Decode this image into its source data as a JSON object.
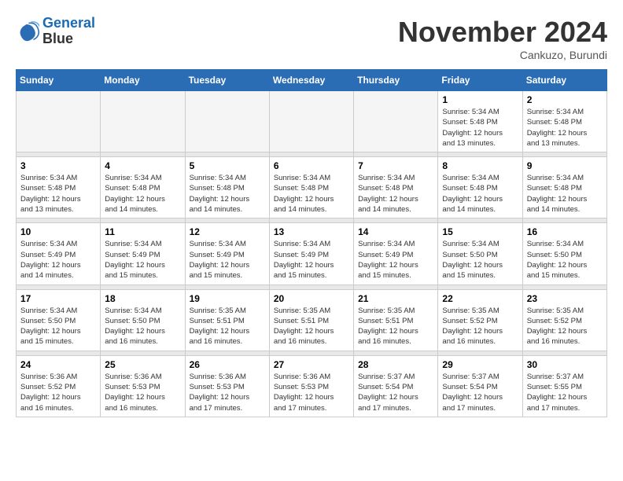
{
  "header": {
    "logo_line1": "General",
    "logo_line2": "Blue",
    "month_title": "November 2024",
    "location": "Cankuzo, Burundi"
  },
  "weekdays": [
    "Sunday",
    "Monday",
    "Tuesday",
    "Wednesday",
    "Thursday",
    "Friday",
    "Saturday"
  ],
  "weeks": [
    {
      "days": [
        {
          "num": "",
          "info": ""
        },
        {
          "num": "",
          "info": ""
        },
        {
          "num": "",
          "info": ""
        },
        {
          "num": "",
          "info": ""
        },
        {
          "num": "",
          "info": ""
        },
        {
          "num": "1",
          "info": "Sunrise: 5:34 AM\nSunset: 5:48 PM\nDaylight: 12 hours\nand 13 minutes."
        },
        {
          "num": "2",
          "info": "Sunrise: 5:34 AM\nSunset: 5:48 PM\nDaylight: 12 hours\nand 13 minutes."
        }
      ]
    },
    {
      "days": [
        {
          "num": "3",
          "info": "Sunrise: 5:34 AM\nSunset: 5:48 PM\nDaylight: 12 hours\nand 13 minutes."
        },
        {
          "num": "4",
          "info": "Sunrise: 5:34 AM\nSunset: 5:48 PM\nDaylight: 12 hours\nand 14 minutes."
        },
        {
          "num": "5",
          "info": "Sunrise: 5:34 AM\nSunset: 5:48 PM\nDaylight: 12 hours\nand 14 minutes."
        },
        {
          "num": "6",
          "info": "Sunrise: 5:34 AM\nSunset: 5:48 PM\nDaylight: 12 hours\nand 14 minutes."
        },
        {
          "num": "7",
          "info": "Sunrise: 5:34 AM\nSunset: 5:48 PM\nDaylight: 12 hours\nand 14 minutes."
        },
        {
          "num": "8",
          "info": "Sunrise: 5:34 AM\nSunset: 5:48 PM\nDaylight: 12 hours\nand 14 minutes."
        },
        {
          "num": "9",
          "info": "Sunrise: 5:34 AM\nSunset: 5:48 PM\nDaylight: 12 hours\nand 14 minutes."
        }
      ]
    },
    {
      "days": [
        {
          "num": "10",
          "info": "Sunrise: 5:34 AM\nSunset: 5:49 PM\nDaylight: 12 hours\nand 14 minutes."
        },
        {
          "num": "11",
          "info": "Sunrise: 5:34 AM\nSunset: 5:49 PM\nDaylight: 12 hours\nand 15 minutes."
        },
        {
          "num": "12",
          "info": "Sunrise: 5:34 AM\nSunset: 5:49 PM\nDaylight: 12 hours\nand 15 minutes."
        },
        {
          "num": "13",
          "info": "Sunrise: 5:34 AM\nSunset: 5:49 PM\nDaylight: 12 hours\nand 15 minutes."
        },
        {
          "num": "14",
          "info": "Sunrise: 5:34 AM\nSunset: 5:49 PM\nDaylight: 12 hours\nand 15 minutes."
        },
        {
          "num": "15",
          "info": "Sunrise: 5:34 AM\nSunset: 5:50 PM\nDaylight: 12 hours\nand 15 minutes."
        },
        {
          "num": "16",
          "info": "Sunrise: 5:34 AM\nSunset: 5:50 PM\nDaylight: 12 hours\nand 15 minutes."
        }
      ]
    },
    {
      "days": [
        {
          "num": "17",
          "info": "Sunrise: 5:34 AM\nSunset: 5:50 PM\nDaylight: 12 hours\nand 15 minutes."
        },
        {
          "num": "18",
          "info": "Sunrise: 5:34 AM\nSunset: 5:50 PM\nDaylight: 12 hours\nand 16 minutes."
        },
        {
          "num": "19",
          "info": "Sunrise: 5:35 AM\nSunset: 5:51 PM\nDaylight: 12 hours\nand 16 minutes."
        },
        {
          "num": "20",
          "info": "Sunrise: 5:35 AM\nSunset: 5:51 PM\nDaylight: 12 hours\nand 16 minutes."
        },
        {
          "num": "21",
          "info": "Sunrise: 5:35 AM\nSunset: 5:51 PM\nDaylight: 12 hours\nand 16 minutes."
        },
        {
          "num": "22",
          "info": "Sunrise: 5:35 AM\nSunset: 5:52 PM\nDaylight: 12 hours\nand 16 minutes."
        },
        {
          "num": "23",
          "info": "Sunrise: 5:35 AM\nSunset: 5:52 PM\nDaylight: 12 hours\nand 16 minutes."
        }
      ]
    },
    {
      "days": [
        {
          "num": "24",
          "info": "Sunrise: 5:36 AM\nSunset: 5:52 PM\nDaylight: 12 hours\nand 16 minutes."
        },
        {
          "num": "25",
          "info": "Sunrise: 5:36 AM\nSunset: 5:53 PM\nDaylight: 12 hours\nand 16 minutes."
        },
        {
          "num": "26",
          "info": "Sunrise: 5:36 AM\nSunset: 5:53 PM\nDaylight: 12 hours\nand 17 minutes."
        },
        {
          "num": "27",
          "info": "Sunrise: 5:36 AM\nSunset: 5:53 PM\nDaylight: 12 hours\nand 17 minutes."
        },
        {
          "num": "28",
          "info": "Sunrise: 5:37 AM\nSunset: 5:54 PM\nDaylight: 12 hours\nand 17 minutes."
        },
        {
          "num": "29",
          "info": "Sunrise: 5:37 AM\nSunset: 5:54 PM\nDaylight: 12 hours\nand 17 minutes."
        },
        {
          "num": "30",
          "info": "Sunrise: 5:37 AM\nSunset: 5:55 PM\nDaylight: 12 hours\nand 17 minutes."
        }
      ]
    }
  ]
}
